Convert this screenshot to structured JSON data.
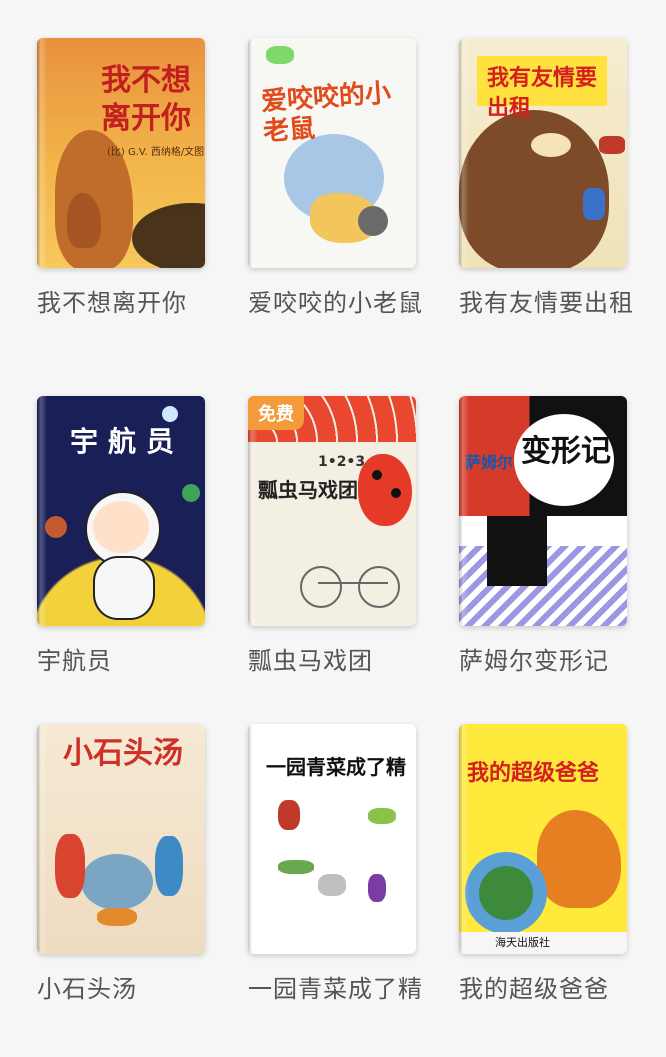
{
  "colors": {
    "page_bg": "#f6f6f6",
    "title_text": "#555555",
    "badge_bg": "#f39a3a"
  },
  "books": [
    {
      "title": "我不想离开你",
      "cover_text": "我不想离开你",
      "cover_bg": "#f0a23c"
    },
    {
      "title": "爱咬咬的小老鼠",
      "cover_text": "爱咬咬的小老鼠",
      "cover_bg": "#f5f5f2"
    },
    {
      "title": "我有友情要出租",
      "cover_text": "我有友情要出租",
      "cover_bg": "#f3e7bf"
    },
    {
      "title": "宇航员",
      "cover_text": "宇航员",
      "cover_bg": "#1b1f58"
    },
    {
      "title": "瓢虫马戏团",
      "cover_text": "瓢虫马戏团",
      "cover_bg": "#f4efe3",
      "badge": "免费"
    },
    {
      "title": "萨姆尔变形记",
      "cover_text": "变形记",
      "cover_bg": "#ffffff"
    },
    {
      "title": "小石头汤",
      "cover_text": "小石头汤",
      "cover_bg": "#f3e6cf"
    },
    {
      "title": "一园青菜成了精",
      "cover_text": "一园青菜成了精",
      "cover_bg": "#ffffff"
    },
    {
      "title": "我的超级爸爸",
      "cover_text": "我的超级爸爸",
      "cover_bg": "#ffe93a"
    }
  ]
}
